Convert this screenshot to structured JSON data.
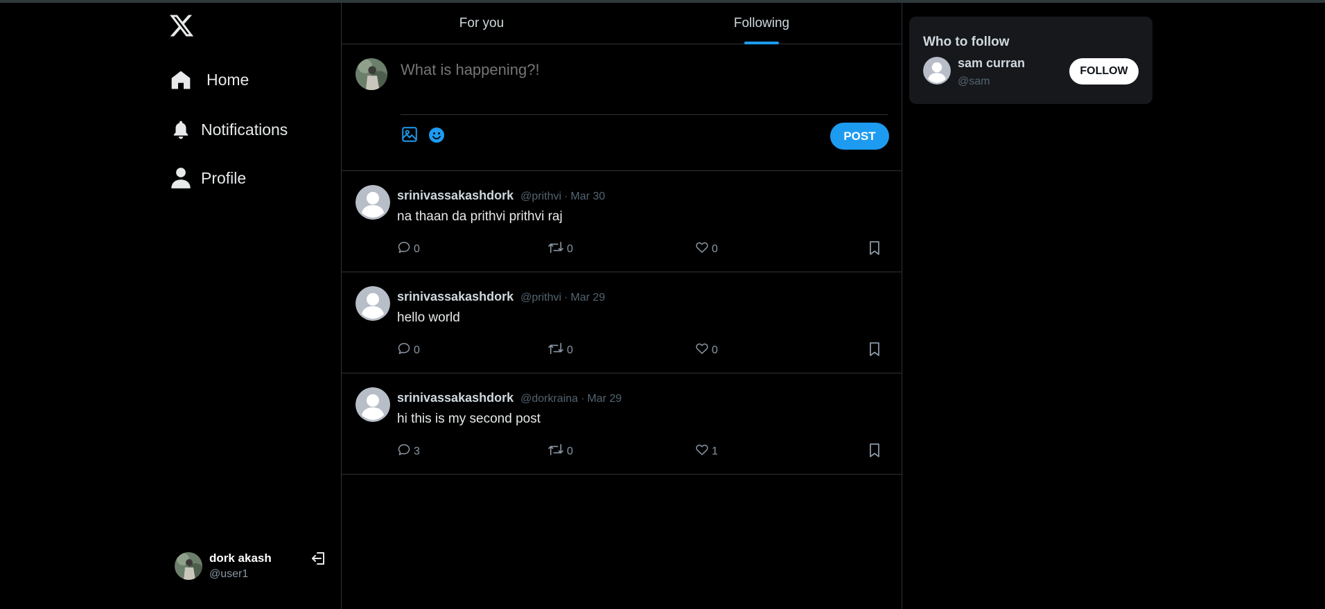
{
  "app": {
    "accent_color": "#1d9bf0",
    "background_color": "#000000"
  },
  "sidebar": {
    "logo_icon": "x-logo-icon",
    "nav": [
      {
        "label": "Home",
        "icon": "home-icon"
      },
      {
        "label": "Notifications",
        "icon": "bell-icon"
      },
      {
        "label": "Profile",
        "icon": "user-icon"
      }
    ],
    "account": {
      "display_name": "dork akash",
      "handle": "@user1",
      "logout_icon": "logout-icon"
    }
  },
  "main": {
    "tabs": [
      {
        "label": "For you",
        "active": false
      },
      {
        "label": "Following",
        "active": true
      }
    ],
    "compose": {
      "placeholder": "What is happening?!",
      "post_label": "POST",
      "media_icon": "image-icon",
      "emoji_icon": "emoji-icon"
    },
    "posts": [
      {
        "name": "srinivassakashdork",
        "handle": "@prithvi",
        "date": "Mar 30",
        "text": "na thaan da prithvi prithvi raj",
        "replies": "0",
        "reposts": "0",
        "likes": "0"
      },
      {
        "name": "srinivassakashdork",
        "handle": "@prithvi",
        "date": "Mar 29",
        "text": "hello world",
        "replies": "0",
        "reposts": "0",
        "likes": "0"
      },
      {
        "name": "srinivassakashdork",
        "handle": "@dorkraina",
        "date": "Mar 29",
        "text": "hi this is my second post",
        "replies": "3",
        "reposts": "0",
        "likes": "1"
      }
    ]
  },
  "who_to_follow": {
    "title": "Who to follow",
    "users": [
      {
        "name": "sam curran",
        "handle": "@sam",
        "button_label": "FOLLOW"
      }
    ]
  }
}
